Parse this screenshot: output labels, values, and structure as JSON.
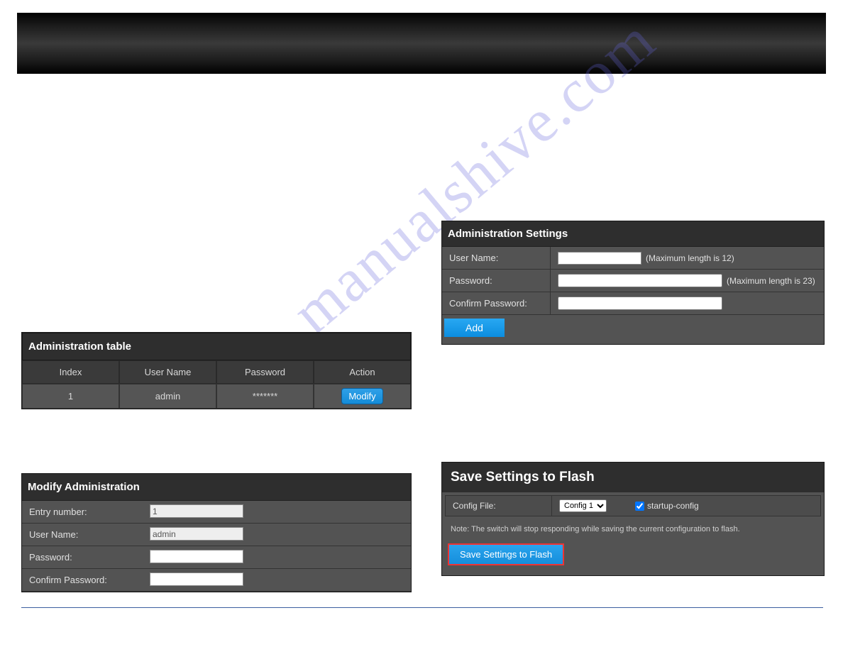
{
  "banner": {},
  "topLink": "",
  "navLink": "",
  "watermark": "manualshive.com",
  "adminTable": {
    "title": "Administration table",
    "headers": [
      "Index",
      "User Name",
      "Password",
      "Action"
    ],
    "rows": [
      {
        "index": "1",
        "user": "admin",
        "password": "*******",
        "action": "Modify"
      }
    ]
  },
  "modifyPanel": {
    "title": "Modify Administration",
    "entryNumberLabel": "Entry number:",
    "entryNumberValue": "1",
    "userNameLabel": "User Name:",
    "userNameValue": "admin",
    "passwordLabel": "Password:",
    "passwordValue": "",
    "confirmLabel": "Confirm Password:",
    "confirmValue": ""
  },
  "settingsPanel": {
    "title": "Administration Settings",
    "userNameLabel": "User Name:",
    "userNameValue": "",
    "userNameHint": "(Maximum length is 12)",
    "passwordLabel": "Password:",
    "passwordValue": "",
    "passwordHint": "(Maximum length is 23)",
    "confirmLabel": "Confirm Password:",
    "confirmValue": "",
    "addButton": "Add"
  },
  "savePanel": {
    "title": "Save Settings to Flash",
    "configFileLabel": "Config File:",
    "configSelected": "Config 1",
    "startupCheckbox": true,
    "startupLabel": "startup-config",
    "note": "Note: The switch will stop responding while saving the current configuration to flash.",
    "saveButton": "Save Settings to Flash"
  }
}
